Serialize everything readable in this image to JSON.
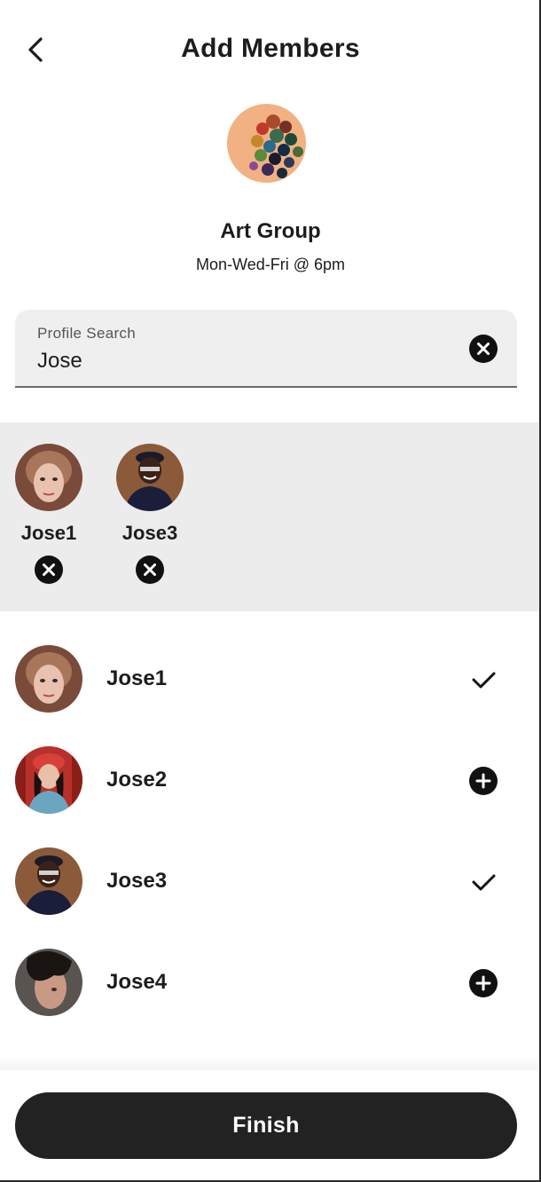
{
  "header": {
    "title": "Add Members"
  },
  "group": {
    "name": "Art Group",
    "schedule": "Mon-Wed-Fri @ 6pm"
  },
  "search": {
    "label": "Profile Search",
    "value": "Jose"
  },
  "selected": [
    {
      "name": "Jose1"
    },
    {
      "name": "Jose3"
    }
  ],
  "results": [
    {
      "name": "Jose1",
      "action_icon": "check-icon"
    },
    {
      "name": "Jose2",
      "action_icon": "add-circle-icon"
    },
    {
      "name": "Jose3",
      "action_icon": "check-icon"
    },
    {
      "name": "Jose4",
      "action_icon": "add-circle-icon"
    }
  ],
  "footer": {
    "finish_label": "Finish"
  },
  "colors": {
    "primary_dark": "#222222",
    "strip_bg": "#ececec",
    "search_bg": "#efefef"
  }
}
